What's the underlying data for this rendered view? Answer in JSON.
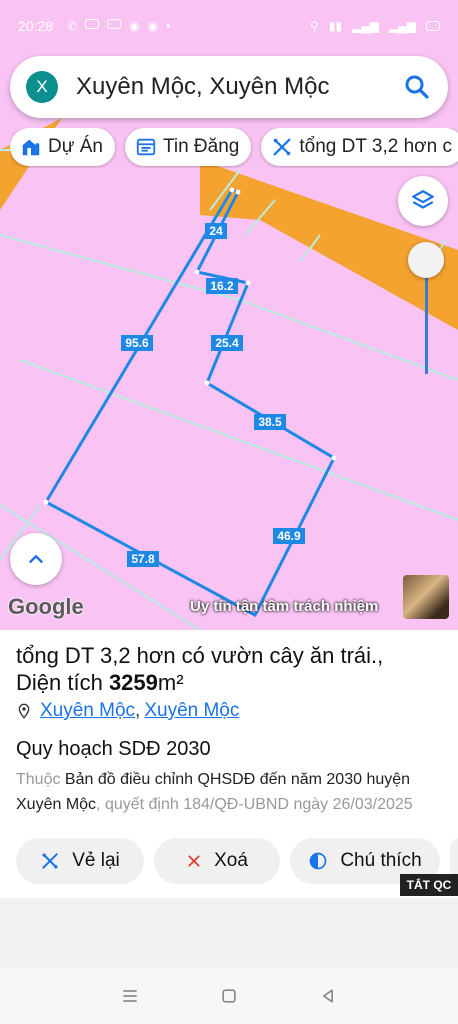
{
  "status_bar": {
    "time": "20:28"
  },
  "search": {
    "logo_letter": "X",
    "query": "Xuyên Mộc, Xuyên Mộc"
  },
  "chips": [
    {
      "label": "Dự Án",
      "icon": "building-icon"
    },
    {
      "label": "Tin Đăng",
      "icon": "listing-icon"
    },
    {
      "label": "tổng DT 3,2 hơn c",
      "icon": "measure-icon"
    }
  ],
  "map": {
    "google_label": "Google",
    "ad_text": "Uy tín tận tâm trách nhiệm",
    "segment_labels": [
      "24",
      "16.2",
      "25.4",
      "95.6",
      "38.5",
      "46.9",
      "57.8"
    ],
    "colors": {
      "land": "#f9c3f4",
      "road": "#f5a32f",
      "parcel_line": "#1e88e5"
    }
  },
  "sheet": {
    "title": "tổng DT 3,2 hơn có vườn cây ăn trái.,",
    "area_prefix": "Diện tích ",
    "area_value": "3259",
    "area_unit": "m²",
    "location_1": "Xuyên Mộc",
    "location_sep": ",",
    "location_2": "Xuyên Mộc",
    "plan_heading": "Quy hoạch SDĐ 2030",
    "plan_prefix": "Thuộc ",
    "plan_name": "Bản đồ điều chỉnh QHSDĐ đến năm 2030 huyện Xuyên Mộc",
    "plan_decision": ", quyết định 184/QĐ-UBND ngày 26/03/2025"
  },
  "actions": [
    {
      "label": "Vẻ lại",
      "icon": "redraw-icon"
    },
    {
      "label": "Xoá",
      "icon": "close-icon"
    },
    {
      "label": "Chú thích",
      "icon": "legend-icon"
    }
  ],
  "ad_badge": "TẮT QC"
}
